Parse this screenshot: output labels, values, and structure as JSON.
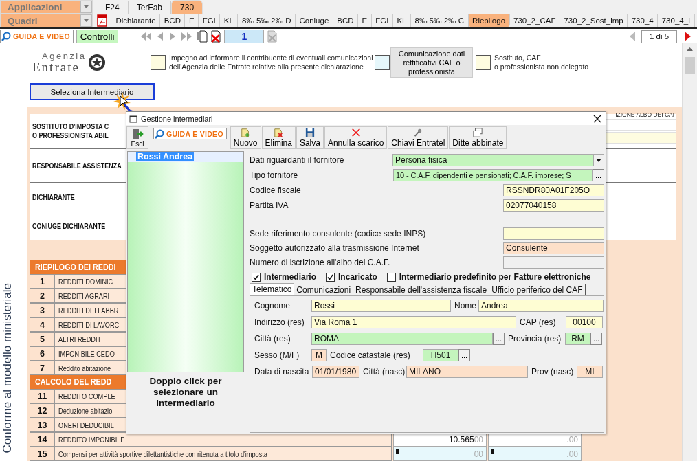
{
  "app_menu": {
    "label": "Applicazioni"
  },
  "top_tabs": [
    {
      "label": "F24",
      "selected": false
    },
    {
      "label": "TerFab",
      "selected": false
    },
    {
      "label": "730",
      "selected": true
    }
  ],
  "section_menu": {
    "label": "Quadri"
  },
  "sheet_tabs": [
    {
      "label": "Dichiarante",
      "selected": false
    },
    {
      "label": "BCD",
      "selected": false
    },
    {
      "label": "E",
      "selected": false
    },
    {
      "label": "FGI",
      "selected": false
    },
    {
      "label": "KL",
      "selected": false
    },
    {
      "label": "8‰  5‰ 2‰ D",
      "selected": false
    },
    {
      "label": "Coniuge",
      "selected": false
    },
    {
      "label": "BCD",
      "selected": false
    },
    {
      "label": "E",
      "selected": false
    },
    {
      "label": "FGI",
      "selected": false
    },
    {
      "label": "KL",
      "selected": false
    },
    {
      "label": "8‰  5‰ 2‰ C",
      "selected": false
    },
    {
      "label": "Riepilogo",
      "selected": true
    },
    {
      "label": "730_2_CAF",
      "selected": false
    },
    {
      "label": "730_2_Sost_imp",
      "selected": false
    },
    {
      "label": "730_4",
      "selected": false
    },
    {
      "label": "730_4_I",
      "selected": false
    }
  ],
  "toolbar": {
    "guide_button": "GUIDA E VIDEO",
    "check_button": "Controlli",
    "page_field": "1",
    "page_indicator": "1 di 5"
  },
  "side_caption": "Conforme al modello ministeriale",
  "logo": [
    "Agenzia",
    "Entrate"
  ],
  "declarations": [
    {
      "text": "Impegno ad informare il contribuente di eventuali comunicazioni dell'Agenzia delle Entrate relative alla presente dichiarazione",
      "checked": false
    },
    {
      "button": "Comunicazione dati rettificativi CAF o professionista",
      "checked": false
    },
    {
      "text": "Sostituto, CAF\no professionista non delegato",
      "checked": false
    }
  ],
  "select_button": "Seleziona Intermediario",
  "albo_label": "IZIONE ALBO DEI CAF",
  "sections": [
    [
      "SOSTITUTO D'IMPOSTA C",
      "O PROFESSIONISTA ABIL"
    ],
    [
      "RESPONSABILE ASSISTENZA"
    ],
    [
      "DICHIARANTE"
    ],
    [
      "CONIUGE DICHIARANTE"
    ]
  ],
  "summary": [
    {
      "title": "RIEPILOGO DEI REDDI",
      "rows": [
        {
          "number": "1",
          "label": "REDDITI DOMINIC"
        },
        {
          "number": "2",
          "label": "REDDITI AGRARI"
        },
        {
          "number": "3",
          "label": "REDDITI DEI FABBR"
        },
        {
          "number": "4",
          "label": "REDDITI DI LAVORC"
        },
        {
          "number": "5",
          "label": "ALTRI REDDITI"
        },
        {
          "number": "6",
          "label": "IMPONIBILE CEDO"
        },
        {
          "number": "7",
          "label": "Reddito abitazione"
        }
      ]
    },
    {
      "title": "CALCOLO DEL REDD",
      "rows": [
        {
          "number": "11",
          "label": "REDDITO COMPLE"
        },
        {
          "number": "12",
          "label": "Deduzione abitazio"
        },
        {
          "number": "13",
          "label": "ONERI DEDUCIBIL"
        },
        {
          "number": "14",
          "label": "REDDITO IMPONIBILE",
          "values": [
            {
              "kind": "computed",
              "int": "10.565",
              "dec": "00",
              "flagged": false
            },
            {
              "kind": "computed",
              "dec": ".00",
              "flagged": false
            }
          ]
        },
        {
          "number": "15",
          "label": "Compensi per attività sportive dilettantistiche con ritenuta a titolo d'imposta",
          "values": [
            {
              "kind": "input",
              "dec": "00",
              "flagged": true
            },
            {
              "kind": "input",
              "dec": ".00",
              "flagged": true
            }
          ]
        }
      ]
    }
  ],
  "dialog": {
    "title": "Gestione intermediari",
    "toolbar": [
      {
        "kind": "exit",
        "label": "Esci"
      },
      {
        "kind": "guide",
        "label": "GUIDA E VIDEO"
      },
      {
        "kind": "new",
        "label": "Nuovo"
      },
      {
        "kind": "delete",
        "label": "Elimina"
      },
      {
        "kind": "save",
        "label": "Salva"
      },
      {
        "kind": "cancel",
        "label": "Annulla scarico"
      },
      {
        "kind": "keys",
        "label": "Chiavi Entratel"
      },
      {
        "kind": "linked",
        "label": "Ditte abbinate"
      }
    ],
    "list": [
      {
        "label": "Rossi Andrea",
        "selected": true
      }
    ],
    "list_hint": "Doppio click per selezionare un intermediario",
    "supplier_fields": [
      {
        "label": "Dati riguardanti il fornitore",
        "value": "Persona fisica",
        "kind": "dropdown"
      },
      {
        "label": "Tipo fornitore",
        "value": "10 - C.A.F. dipendenti e pensionati; C.A.F. imprese; S",
        "kind": "lookup",
        "button": "..."
      },
      {
        "label": "Codice fiscale",
        "value": "RSSNDR80A01F205O",
        "kind": "input"
      },
      {
        "label": "Partita IVA",
        "value": "02077040158",
        "kind": "input"
      }
    ],
    "caf_fields": [
      {
        "label": "Sede riferimento consulente (codice sede INPS)",
        "kind": "input"
      },
      {
        "label": "Soggetto autorizzato alla trasmissione Internet",
        "value": "Consulente",
        "kind": "derived"
      },
      {
        "label": "Numero di iscrizione all'albo dei C.A.F.",
        "kind": "readonly"
      }
    ],
    "options": [
      {
        "label": "Intermediario",
        "checked": true
      },
      {
        "label": "Incaricato",
        "checked": true
      },
      {
        "label": "Intermediario predefinito per Fatture elettroniche",
        "checked": false
      }
    ],
    "tabs": [
      {
        "label": "Telematico",
        "selected": true
      },
      {
        "label": "Comunicazioni",
        "selected": false
      },
      {
        "label": "Responsabile dell'assistenza fiscale",
        "selected": false
      },
      {
        "label": "Ufficio periferico del CAF",
        "selected": false
      }
    ],
    "person_rows": [
      [
        {
          "label": "Cognome",
          "value": "Rossi",
          "kind": "input"
        },
        {
          "label": "Nome",
          "value": "Andrea",
          "kind": "input"
        }
      ],
      [
        {
          "label": "Indirizzo (res)",
          "value": "Via Roma 1",
          "kind": "input"
        },
        {
          "label": "CAP (res)",
          "value": "00100",
          "kind": "input"
        }
      ],
      [
        {
          "label": "Città (res)",
          "value": "ROMA",
          "kind": "lookup",
          "button": "..."
        },
        {
          "label": "Provincia (res)",
          "value": "RM",
          "kind": "lookup",
          "button": "..."
        }
      ],
      [
        {
          "label": "Sesso (M/F)",
          "value": "M",
          "kind": "derived"
        },
        {
          "label": "Codice catastale (res)",
          "value": "H501",
          "kind": "lookup",
          "button": "..."
        }
      ],
      [
        {
          "label": "Data di nascita",
          "value": "01/01/1980",
          "kind": "derived"
        },
        {
          "label": "Città (nasc)",
          "value": "MILANO",
          "kind": "derived"
        },
        {
          "label": "Prov (nasc)",
          "value": "MI",
          "kind": "derived"
        }
      ]
    ]
  }
}
